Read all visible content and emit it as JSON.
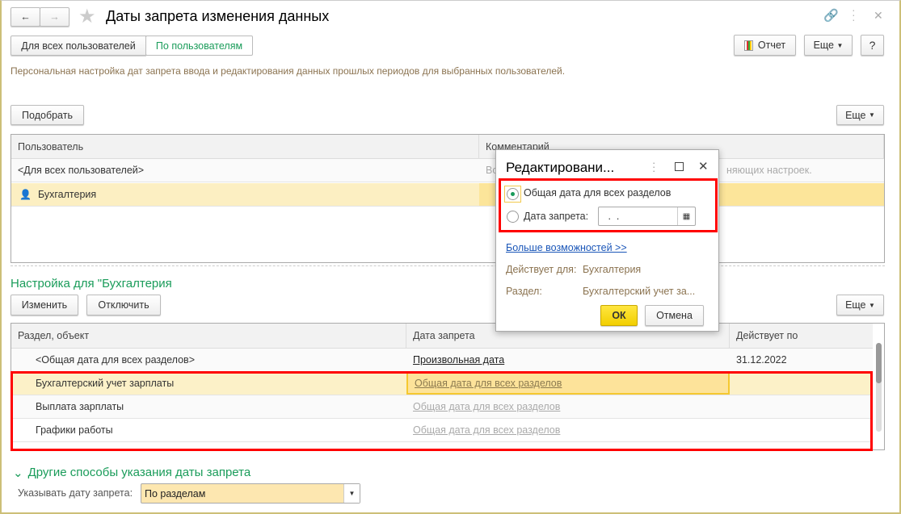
{
  "header": {
    "title": "Даты запрета изменения данных",
    "back": "←",
    "forward": "→"
  },
  "tabs": [
    {
      "label": "Для всех пользователей"
    },
    {
      "label": "По пользователям"
    }
  ],
  "toolbar": {
    "report": "Отчет",
    "more": "Еще",
    "help": "?"
  },
  "description": "Персональная настройка дат запрета ввода и редактирования данных прошлых периодов для выбранных пользователей.",
  "users": {
    "pick": "Подобрать",
    "more": "Еще",
    "columns": [
      "Пользователь",
      "Комментарий"
    ],
    "rows": [
      {
        "user": "<Для всех пользователей>",
        "comment_start": "Во",
        "comment_end": "няющих настроек."
      },
      {
        "user": "Бухгалтерия",
        "comment": ""
      }
    ]
  },
  "settings": {
    "title": "Настройка для \"Бухгалтерия",
    "change": "Изменить",
    "disable": "Отключить",
    "more": "Еще",
    "columns": [
      "Раздел, объект",
      "Дата запрета",
      "Действует по"
    ],
    "rows": [
      {
        "section": "<Общая дата для всех разделов>",
        "date": "Произвольная дата",
        "until": "31.12.2022"
      },
      {
        "section": "Бухгалтерский учет зарплаты",
        "date": "Общая дата для всех разделов",
        "until": ""
      },
      {
        "section": "Выплата зарплаты",
        "date": "Общая дата для всех разделов",
        "until": ""
      },
      {
        "section": "Графики работы",
        "date": "Общая дата для всех разделов",
        "until": ""
      }
    ]
  },
  "other": {
    "title": "Другие способы указания даты запрета",
    "label": "Указывать дату запрета:",
    "value": "По разделам"
  },
  "dialog": {
    "title": "Редактировани...",
    "opt1": "Общая дата для всех разделов",
    "opt2": "Дата запрета:",
    "date_value": " .  . ",
    "more_link": "Больше возможностей >>",
    "applies_label": "Действует для:",
    "applies_value": "Бухгалтерия",
    "section_label": "Раздел:",
    "section_value": "Бухгалтерский учет за...",
    "ok": "ОК",
    "cancel": "Отмена"
  }
}
